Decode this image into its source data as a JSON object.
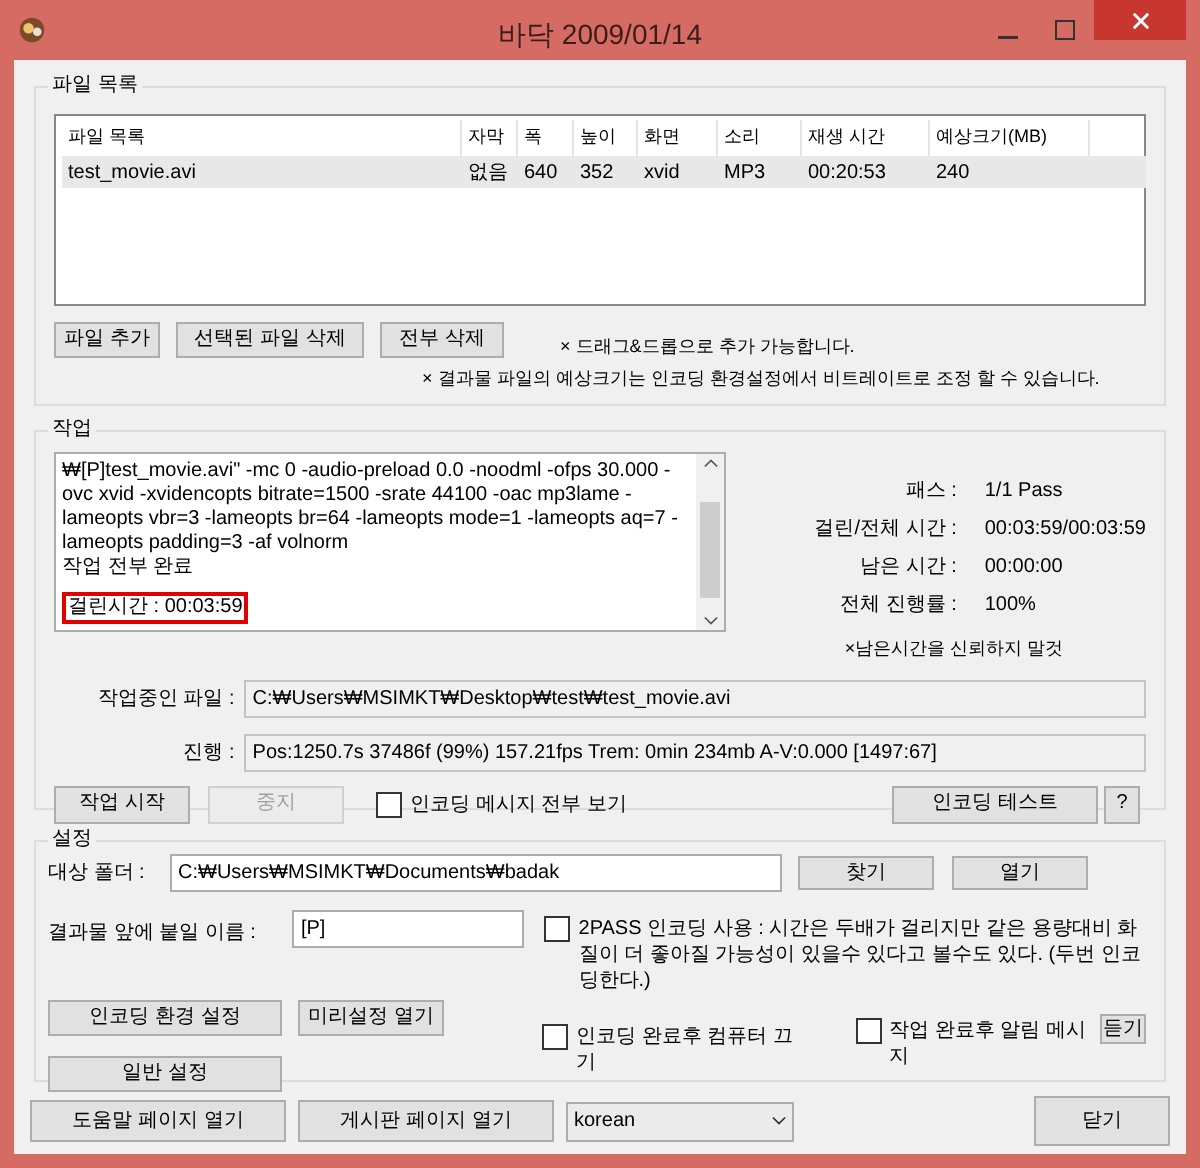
{
  "window": {
    "title": "바닥 2009/01/14"
  },
  "file_list": {
    "label": "파일 목록",
    "columns": [
      "파일 목록",
      "자막",
      "폭",
      "높이",
      "화면",
      "소리",
      "재생 시간",
      "예상크기(MB)"
    ],
    "rows": [
      {
        "cells": [
          "test_movie.avi",
          "없음",
          "640",
          "352",
          "xvid",
          "MP3",
          "00:20:53",
          "240"
        ],
        "selected": true
      }
    ]
  },
  "file_buttons": [
    "파일 추가",
    "선택된 파일 삭제",
    "전부 삭제"
  ],
  "notes": [
    "× 드래그&드롭으로 추가 가능합니다.",
    "× 결과물 파일의 예상크기는 인코딩 환경설정에서 비트레이트로 조정 할 수 있습니다."
  ],
  "work": {
    "label": "작업",
    "log": [
      {
        "text": "₩[P]test_movie.avi\" -mc 0 -audio-preload 0.0 -noodml -ofps 30.000 -ovc xvid -xvidencopts bitrate=1500 -srate 44100 -oac mp3lame -lameopts vbr=3  -lameopts br=64 -lameopts mode=1 -lameopts aq=7 -lameopts padding=3 -af volnorm",
        "highlighted": false
      },
      {
        "text": "작업 전부 완료",
        "highlighted": false
      },
      {
        "text": "걸린시간 : 00:03:59",
        "highlighted": true
      }
    ],
    "stats": [
      {
        "label": "패스 :",
        "value": "1/1 Pass"
      },
      {
        "label": "걸린/전체 시간 :",
        "value": "00:03:59/00:03:59"
      },
      {
        "label": "남은 시간 :",
        "value": "00:00:00"
      },
      {
        "label": "전체 진행률 :",
        "value": "100%"
      }
    ],
    "note": "×남은시간을 신뢰하지 말것",
    "current_file": {
      "label": "작업중인 파일 :",
      "value": "C:₩Users₩MSIMKT₩Desktop₩test₩test_movie.avi"
    },
    "progress": {
      "label": "진행 :",
      "value": "Pos:1250.7s  37486f (99%) 157.21fps Trem:   0min 234mb  A-V:0.000 [1497:67]"
    },
    "buttons": [
      {
        "label": "작업 시작",
        "disabled": false
      },
      {
        "label": "중지",
        "disabled": true
      }
    ],
    "show_all": {
      "label": "인코딩 메시지 전부 보기",
      "checked": false
    },
    "test_button": "인코딩 테스트",
    "help_button": "?"
  },
  "settings": {
    "label": "설정",
    "folder": {
      "label": "대상 폴더 :",
      "value": "C:₩Users₩MSIMKT₩Documents₩badak"
    },
    "folder_buttons": [
      "찾기",
      "열기"
    ],
    "prefix": {
      "label": "결과물 앞에 붙일 이름 :",
      "value": "[P]"
    },
    "two_pass": {
      "label": "2PASS 인코딩 사용 : 시간은 두배가 걸리지만 같은 용량대비 화질이 더 좋아질 가능성이 있을수 있다고 볼수도 있다. (두번 인코딩한다.)",
      "checked": false
    },
    "buttons": [
      "인코딩 환경 설정",
      "미리설정 열기",
      "일반 설정"
    ],
    "shutdown": {
      "label": "인코딩 완료후 컴퓨터 끄기",
      "checked": false
    },
    "notify": {
      "label": "작업 완료후 알림 메시지",
      "checked": false
    },
    "listen_button": "듣기"
  },
  "bottom": {
    "help_button": "도움말 페이지 열기",
    "board_button": "게시판 페이지 열기",
    "language": "korean",
    "close_button": "닫기"
  }
}
